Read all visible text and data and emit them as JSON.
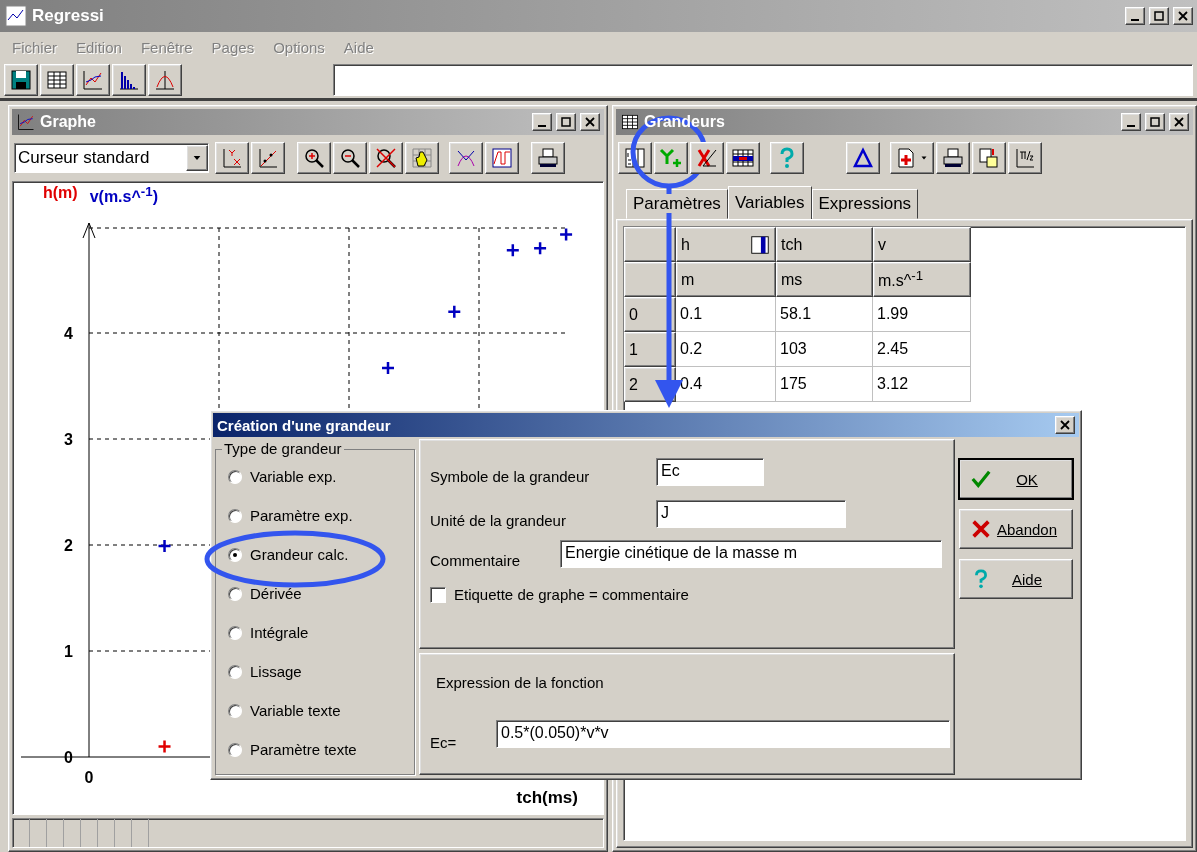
{
  "app_window": {
    "title": "Regressi"
  },
  "menu": [
    "Fichier",
    "Edition",
    "Fenêtre",
    "Pages",
    "Options",
    "Aide"
  ],
  "graph_window": {
    "title": "Graphe",
    "cursor_select": "Curseur standard",
    "axis_labels": [
      {
        "text": "h(m)",
        "color": "#e00000"
      },
      {
        "text": "v(m.s^$^{-1}$)",
        "color": "#0000c0"
      }
    ],
    "y_tick_labels": [
      "4",
      "3",
      "2",
      "1",
      "0"
    ],
    "x_origin_label": "0",
    "x_axis_title": "tch(ms)"
  },
  "grandeurs_window": {
    "title": "Grandeurs",
    "tabs": [
      {
        "label": "Paramètres",
        "selected": false
      },
      {
        "label": "Variables",
        "selected": true
      },
      {
        "label": "Expressions",
        "selected": false
      }
    ],
    "columns": [
      {
        "name": "h",
        "unit": "m"
      },
      {
        "name": "tch",
        "unit": "ms"
      },
      {
        "name": "v",
        "unit": "m.s^$^{-1}$"
      }
    ],
    "rows": [
      {
        "index": "0",
        "cells": [
          "0.1",
          "58.1",
          "1.99"
        ]
      },
      {
        "index": "1",
        "cells": [
          "0.2",
          "103",
          "2.45"
        ]
      },
      {
        "index": "2",
        "cells": [
          "0.4",
          "175",
          "3.12"
        ]
      }
    ]
  },
  "dialog": {
    "title": "Création d'une grandeur",
    "group_title": "Type de grandeur",
    "options": [
      {
        "label": "Variable exp.",
        "selected": false
      },
      {
        "label": "Paramètre exp.",
        "selected": false
      },
      {
        "label": "Grandeur calc.",
        "selected": true
      },
      {
        "label": "Dérivée",
        "selected": false
      },
      {
        "label": "Intégrale",
        "selected": false
      },
      {
        "label": "Lissage",
        "selected": false
      },
      {
        "label": "Variable texte",
        "selected": false
      },
      {
        "label": "Paramètre texte",
        "selected": false
      }
    ],
    "symbol_label": "Symbole de la grandeur",
    "symbol_value": "Ec",
    "unit_label": "Unité de la grandeur",
    "unit_value": "J",
    "comment_label": "Commentaire",
    "comment_value": "Energie cinétique de la masse m",
    "checkbox": {
      "label": "Etiquette de graphe = commentaire",
      "checked": false
    },
    "expression_title": "Expression de la fonction",
    "expression_label": "Ec=",
    "expression_value": "0.5*(0.050)*v*v",
    "buttons": [
      {
        "label": "OK",
        "kind": "ok"
      },
      {
        "label": "Abandon",
        "kind": "cancel"
      },
      {
        "label": "Aide",
        "kind": "help"
      }
    ]
  }
}
